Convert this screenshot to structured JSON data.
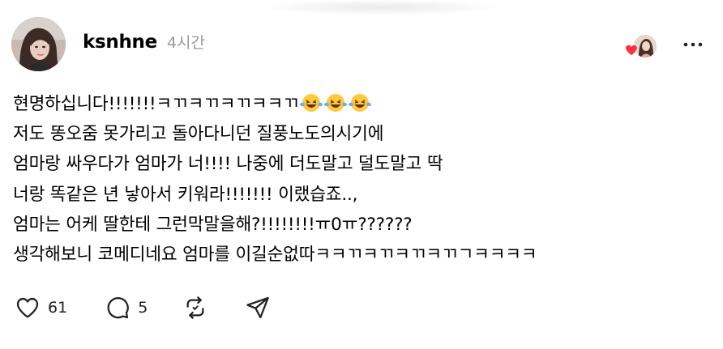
{
  "post": {
    "author": {
      "username": "ksnhne",
      "time": "4시간"
    },
    "lines": [
      "현명하십니다!!!!!!!ㅋㄲㅋㄲㅋㄲㅋㅋㄲ",
      "저도 똥오줌 못가리고 돌아다니던 질풍노도의시기에",
      "엄마랑 싸우다가 엄마가 너!!!! 나중에 더도말고 덜도말고 딱",
      "너랑 똑같은 년 낳아서 키워라!!!!!!! 이랬습죠..,",
      "엄마는 어케 딸한테 그런막말을해?!!!!!!!!ㅠ0ㅠ??????",
      "생각해보니 코메디네요 엄마를 이길순없따ㅋㅋㄲㅋㄲㅋㄲㅋㄲㄱㅋㅋㅋㅋ"
    ],
    "emoji": [
      "face-with-tears-of-joy",
      "face-with-tears-of-joy",
      "face-with-tears-of-joy"
    ],
    "icons": {
      "like": "heart-outline-icon",
      "comment": "comment-bubble-icon",
      "repost": "repost-icon",
      "share": "send-icon",
      "more": "more-horizontal-icon",
      "liker_heart": "red-heart-icon"
    },
    "stats": {
      "likes": "61",
      "comments": "5"
    },
    "colors": {
      "heart_red": "#ff3040",
      "muted_text": "#999999",
      "emoji_yellow": "#ffc83d"
    }
  }
}
